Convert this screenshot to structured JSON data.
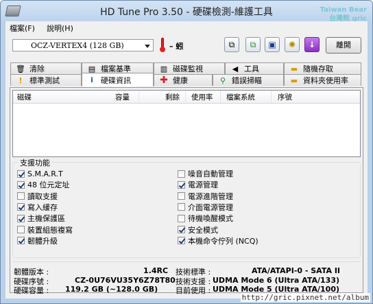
{
  "window": {
    "title": "HD Tune Pro 3.50 - 硬碟檢測-維護工具",
    "watermark": [
      "Taiwan Bear",
      "台灣熊 gric"
    ]
  },
  "menu": [
    "檔案(F)",
    "說明(H)"
  ],
  "toolbar": {
    "drive": "OCZ-VERTEX4 (128 GB)",
    "temperature": "– 蚓",
    "exit_label": "離開"
  },
  "tabs_row1": [
    "清除",
    "檔案基準",
    "磁碟監視",
    "工具",
    "隨機存取"
  ],
  "tabs_row2": [
    "標準測試",
    "硬碟資訊",
    "健康",
    "錯誤掃瞄",
    "資料夾使用率"
  ],
  "active_tab": "硬碟資訊",
  "list": {
    "columns": [
      "磁碟",
      "容量",
      "剩餘",
      "使用率",
      "檔案系統",
      "序號"
    ]
  },
  "features": {
    "label": "支援功能",
    "left": [
      {
        "label": "S.M.A.R.T",
        "checked": true
      },
      {
        "label": "48 位元定址",
        "checked": true
      },
      {
        "label": "讀取支援",
        "checked": false
      },
      {
        "label": "寫入緩存",
        "checked": true
      },
      {
        "label": "主機保護區",
        "checked": true
      },
      {
        "label": "裝置組態複寫",
        "checked": false
      },
      {
        "label": "韌體升級",
        "checked": true
      }
    ],
    "right": [
      {
        "label": "噪音自動管理",
        "checked": false
      },
      {
        "label": "電源管理",
        "checked": true
      },
      {
        "label": "電源進階管理",
        "checked": false
      },
      {
        "label": "介面電源管理",
        "checked": false
      },
      {
        "label": "待機喚醒模式",
        "checked": false
      },
      {
        "label": "安全模式",
        "checked": true
      },
      {
        "label": "本機命令佇列 (NCQ)",
        "checked": true
      }
    ]
  },
  "info": {
    "firmware_label": "韌體版本 :",
    "firmware": "1.4RC",
    "serial_label": "硬碟序號 :",
    "serial": "CZ-0U76VU35Y6Z78T80",
    "capacity_label": "硬碟容量 :",
    "capacity": "119.2 GB (~128.0 GB)",
    "standard_label": "技術標準 :",
    "standard": "ATA/ATAPI-0 - SATA II",
    "supported_label": "技術支援 :",
    "supported": "UDMA Mode 6 (Ultra ATA/133)",
    "current_label": "目前使用 :",
    "current": "UDMA Mode 5 (Ultra ATA/100)"
  },
  "footer_watermark": "http://gric.pixnet.net/album"
}
